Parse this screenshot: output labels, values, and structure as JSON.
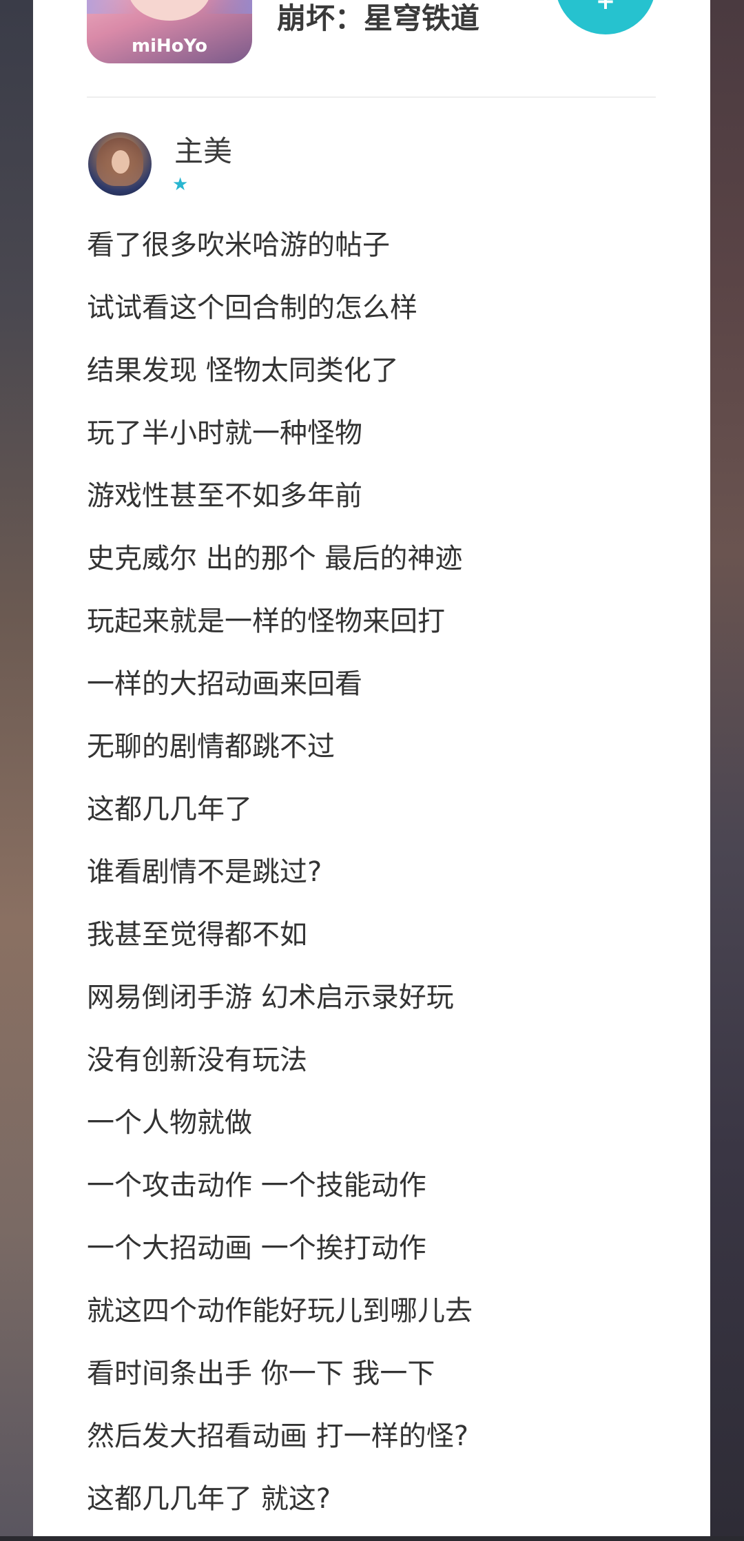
{
  "app": {
    "name": "崩坏：星穹铁道",
    "logo_text": "miHoYo",
    "follow_label": "+"
  },
  "post": {
    "author": "主美",
    "author_badge": "★",
    "lines": [
      "看了很多吹米哈游的帖子",
      "试试看这个回合制的怎么样",
      "结果发现 怪物太同类化了",
      "玩了半小时就一种怪物",
      "游戏性甚至不如多年前",
      "史克威尔 出的那个 最后的神迹",
      "玩起来就是一样的怪物来回打",
      "一样的大招动画来回看",
      "无聊的剧情都跳不过",
      "这都几几年了",
      "谁看剧情不是跳过?",
      "我甚至觉得都不如",
      "网易倒闭手游 幻术启示录好玩",
      "没有创新没有玩法",
      "一个人物就做",
      "一个攻击动作 一个技能动作",
      "一个大招动画 一个挨打动作",
      "就这四个动作能好玩儿到哪儿去",
      "看时间条出手 你一下 我一下",
      "然后发大招看动画 打一样的怪?",
      "这都几几年了 就这?"
    ]
  },
  "colors": {
    "accent": "#26c2cf",
    "text": "#333333",
    "badge": "#29b6d0"
  }
}
